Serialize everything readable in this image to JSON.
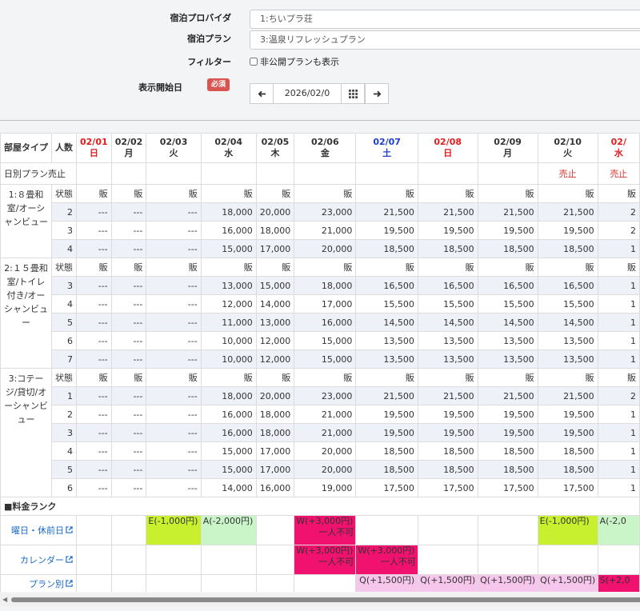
{
  "form": {
    "provider_label": "宿泊プロバイダ",
    "provider_value": "1:ちいプラ荘",
    "plan_label": "宿泊プラン",
    "plan_value": "3:温泉リフレッシュプラン",
    "filter_label": "フィルター",
    "filter_checkbox_label": "非公開プランも表示",
    "start_date_label": "表示開始日",
    "required_badge": "必須",
    "start_date_value": "2026/02/0",
    "prev_icon": "arrow-left-icon",
    "next_icon": "arrow-right-icon",
    "calendar_icon": "grid-calendar-icon"
  },
  "colors": {
    "sunday": "#e31c1c",
    "saturday": "#1a3fd0",
    "sale": "#d0312d",
    "rank_e": "#c8f02f",
    "rank_a": "#c9f5c9",
    "rank_w": "#f0126e",
    "rank_q": "#f7c6ec",
    "link": "#1a6bc7"
  },
  "table": {
    "room_type_header": "部屋タイプ",
    "people_header": "人数",
    "daily_sale_label": "日別プラン売止",
    "status_label": "状態",
    "status_value": "販",
    "sale_stop_label": "売止",
    "days": [
      {
        "date": "02/01",
        "weekday": "日",
        "kind": "sun",
        "sale": ""
      },
      {
        "date": "02/02",
        "weekday": "月",
        "kind": "",
        "sale": ""
      },
      {
        "date": "02/03",
        "weekday": "火",
        "kind": "",
        "sale": ""
      },
      {
        "date": "02/04",
        "weekday": "水",
        "kind": "",
        "sale": ""
      },
      {
        "date": "02/05",
        "weekday": "木",
        "kind": "",
        "sale": ""
      },
      {
        "date": "02/06",
        "weekday": "金",
        "kind": "",
        "sale": ""
      },
      {
        "date": "02/07",
        "weekday": "土",
        "kind": "sat",
        "sale": ""
      },
      {
        "date": "02/08",
        "weekday": "日",
        "kind": "sun",
        "sale": ""
      },
      {
        "date": "02/09",
        "weekday": "月",
        "kind": "",
        "sale": ""
      },
      {
        "date": "02/10",
        "weekday": "火",
        "kind": "",
        "sale": "売止"
      },
      {
        "date": "02/",
        "weekday": "水",
        "kind": "sun",
        "sale": "売止"
      }
    ],
    "rooms": [
      {
        "name": "1:８畳和室/オーシャンビュー",
        "rows": [
          {
            "people": "2",
            "prices": [
              "---",
              "---",
              "---",
              "18,000",
              "20,000",
              "23,000",
              "21,500",
              "21,500",
              "21,500",
              "21,500",
              "2"
            ]
          },
          {
            "people": "3",
            "prices": [
              "---",
              "---",
              "---",
              "16,000",
              "18,000",
              "21,000",
              "19,500",
              "19,500",
              "19,500",
              "19,500",
              "2"
            ]
          },
          {
            "people": "4",
            "prices": [
              "---",
              "---",
              "---",
              "15,000",
              "17,000",
              "20,000",
              "18,500",
              "18,500",
              "18,500",
              "18,500",
              "1"
            ]
          }
        ]
      },
      {
        "name": "2:１５畳和室/トイレ付き/オーシャンビュー",
        "rows": [
          {
            "people": "3",
            "prices": [
              "---",
              "---",
              "---",
              "13,000",
              "15,000",
              "18,000",
              "16,500",
              "16,500",
              "16,500",
              "16,500",
              "1"
            ]
          },
          {
            "people": "4",
            "prices": [
              "---",
              "---",
              "---",
              "12,000",
              "14,000",
              "17,000",
              "15,500",
              "15,500",
              "15,500",
              "15,500",
              "1"
            ]
          },
          {
            "people": "5",
            "prices": [
              "---",
              "---",
              "---",
              "11,000",
              "13,000",
              "16,000",
              "14,500",
              "14,500",
              "14,500",
              "14,500",
              "1"
            ]
          },
          {
            "people": "6",
            "prices": [
              "---",
              "---",
              "---",
              "10,000",
              "12,000",
              "15,000",
              "13,500",
              "13,500",
              "13,500",
              "13,500",
              "1"
            ]
          },
          {
            "people": "7",
            "prices": [
              "---",
              "---",
              "---",
              "10,000",
              "12,000",
              "15,000",
              "13,500",
              "13,500",
              "13,500",
              "13,500",
              "1"
            ]
          }
        ]
      },
      {
        "name": "3:コテージ/貸切/オーシャンビュー",
        "rows": [
          {
            "people": "1",
            "prices": [
              "---",
              "---",
              "---",
              "18,000",
              "20,000",
              "23,000",
              "21,500",
              "21,500",
              "21,500",
              "21,500",
              "2"
            ]
          },
          {
            "people": "2",
            "prices": [
              "---",
              "---",
              "---",
              "16,000",
              "18,000",
              "21,000",
              "19,500",
              "19,500",
              "19,500",
              "19,500",
              "1"
            ]
          },
          {
            "people": "3",
            "prices": [
              "---",
              "---",
              "---",
              "16,000",
              "18,000",
              "21,000",
              "19,500",
              "19,500",
              "19,500",
              "19,500",
              "1"
            ]
          },
          {
            "people": "4",
            "prices": [
              "---",
              "---",
              "---",
              "15,000",
              "17,000",
              "20,000",
              "18,500",
              "18,500",
              "18,500",
              "18,500",
              "1"
            ]
          },
          {
            "people": "5",
            "prices": [
              "---",
              "---",
              "---",
              "15,000",
              "17,000",
              "20,000",
              "18,500",
              "18,500",
              "18,500",
              "18,500",
              "1"
            ]
          },
          {
            "people": "6",
            "prices": [
              "---",
              "---",
              "---",
              "14,000",
              "16,000",
              "19,000",
              "17,500",
              "17,500",
              "17,500",
              "17,500",
              "1"
            ]
          }
        ]
      }
    ],
    "rank_section_label": "■料金ランク",
    "rank_rows": [
      {
        "label": "曜日・休前日",
        "cells": [
          null,
          null,
          {
            "cls": "rk-e",
            "l1": "E(-1,000円)",
            "l2": ""
          },
          {
            "cls": "rk-a",
            "l1": "A(-2,000円)",
            "l2": ""
          },
          null,
          {
            "cls": "rk-w",
            "l1": "W(+3,000円)",
            "l2": "一人不可"
          },
          null,
          null,
          null,
          {
            "cls": "rk-e",
            "l1": "E(-1,000円)",
            "l2": ""
          },
          {
            "cls": "rk-a",
            "l1": "A(-2,0",
            "l2": ""
          }
        ]
      },
      {
        "label": "カレンダー",
        "cells": [
          null,
          null,
          null,
          null,
          null,
          {
            "cls": "rk-w",
            "l1": "W(+3,000円)",
            "l2": "一人不可"
          },
          {
            "cls": "rk-w",
            "l1": "W(+3,000円)",
            "l2": "一人不可"
          },
          null,
          null,
          null,
          null
        ]
      },
      {
        "label": "プラン別",
        "cells": [
          null,
          null,
          null,
          null,
          null,
          null,
          {
            "cls": "rk-q",
            "l1": "Q(+1,500円)",
            "l2": ""
          },
          {
            "cls": "rk-q",
            "l1": "Q(+1,500円)",
            "l2": ""
          },
          {
            "cls": "rk-q",
            "l1": "Q(+1,500円)",
            "l2": ""
          },
          {
            "cls": "rk-q",
            "l1": "Q(+1,500円)",
            "l2": ""
          },
          {
            "cls": "rk-s",
            "l1": "S(+2,0",
            "l2": ""
          }
        ]
      }
    ]
  }
}
